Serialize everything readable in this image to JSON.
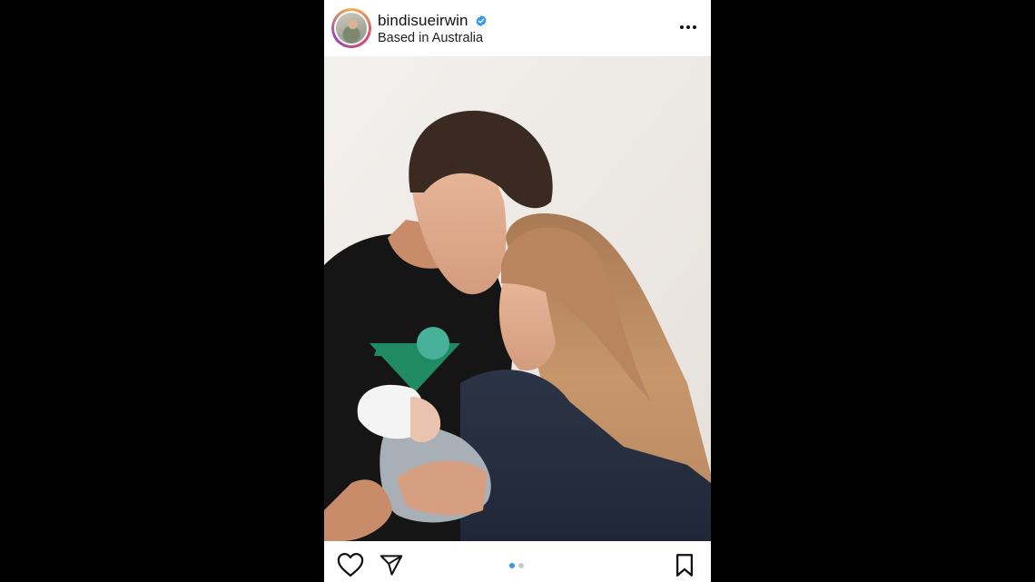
{
  "header": {
    "username": "bindisueirwin",
    "location": "Based in Australia",
    "verified_icon": "verified-badge-icon",
    "more_icon": "more-options-icon"
  },
  "post": {
    "photo_description_icon": "photo"
  },
  "actions": {
    "like_icon": "heart-icon",
    "share_icon": "send-icon",
    "save_icon": "bookmark-icon",
    "carousel_total": 2,
    "carousel_active": 1
  },
  "colors": {
    "background": "#000000",
    "verified_blue": "#3797f0",
    "active_dot": "#3797f0",
    "inactive_dot": "#c8c8c8"
  }
}
